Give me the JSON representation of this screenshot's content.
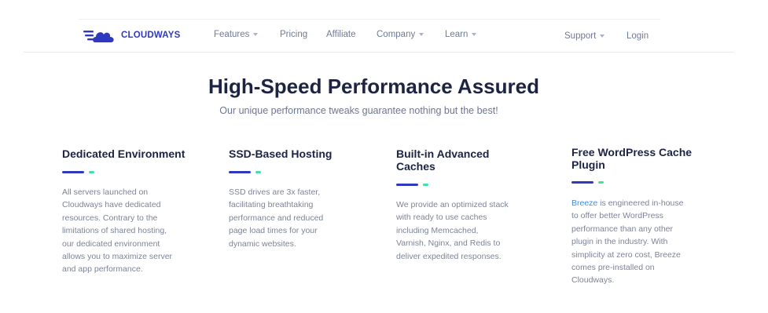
{
  "brand": {
    "name": "CLOUDWAYS",
    "color": "#2f39bf"
  },
  "nav": {
    "features": "Features",
    "pricing": "Pricing",
    "affiliate": "Affiliate",
    "company": "Company",
    "learn": "Learn",
    "support": "Support",
    "login": "Login"
  },
  "hero": {
    "title": "High-Speed Performance Assured",
    "subtitle": "Our unique performance tweaks guarantee nothing but the best!"
  },
  "features": [
    {
      "title": "Dedicated Environment",
      "lines": [
        "All servers launched on",
        "Cloudways have dedicated",
        "resources. Contrary to the",
        "limitations of shared hosting,",
        "our dedicated environment",
        "allows you to maximize server",
        "and app performance."
      ]
    },
    {
      "title": "SSD-Based Hosting",
      "lines": [
        "SSD drives are 3x faster,",
        "facilitating breathtaking",
        "performance and reduced",
        "page load times for your",
        "dynamic websites."
      ]
    },
    {
      "title_lines": [
        "Built-in Advanced",
        "Caches"
      ],
      "lines": [
        "We provide an optimized stack",
        "with ready to use caches",
        "including Memcached,",
        "Varnish, Nginx, and Redis to",
        "deliver expedited responses."
      ]
    },
    {
      "title_lines": [
        "Free WordPress Cache",
        "Plugin"
      ],
      "link_text": "Breeze",
      "first_line_rest": " is engineered in-house",
      "lines": [
        "to offer better WordPress",
        "performance than any other",
        "plugin in the industry. With",
        "simplicity at zero cost, Breeze",
        "comes pre-installed on",
        "Cloudways."
      ]
    }
  ],
  "colors": {
    "accent_blue": "#2f39bf",
    "accent_green": "#3ee2a8",
    "link": "#3f8ee0",
    "heading": "#1d2443"
  },
  "icons": {
    "logo": "cloud-speed-icon",
    "dropdown": "chevron-down-icon"
  }
}
